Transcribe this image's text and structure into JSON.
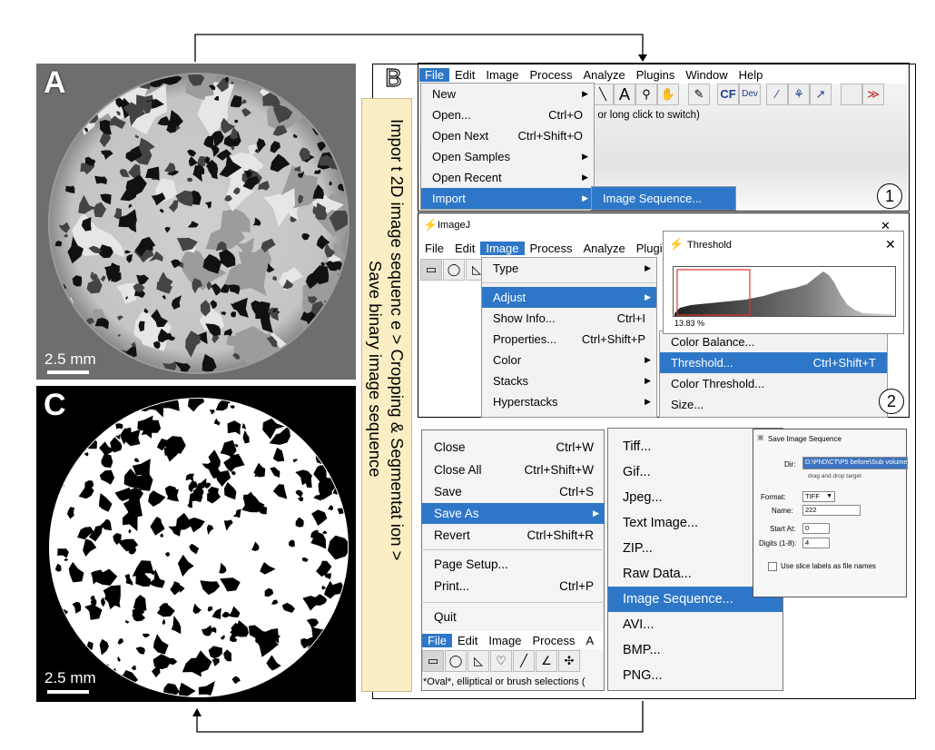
{
  "panels": {
    "a_label": "A",
    "b_label": "B",
    "c_label": "C",
    "scale_a": "2.5 mm",
    "scale_c": "2.5 mm"
  },
  "workflow_label": {
    "line1": "Impor t 2D image sequenc e > Cropping  & Segmentat ion >",
    "line2": "Save binary image sequence"
  },
  "step1": {
    "menubar": [
      "File",
      "Edit",
      "Image",
      "Process",
      "Analyze",
      "Plugins",
      "Window",
      "Help"
    ],
    "file_menu": [
      {
        "label": "New",
        "shortcut": "",
        "submenu": true
      },
      {
        "label": "Open...",
        "shortcut": "Ctrl+O",
        "submenu": false
      },
      {
        "label": "Open Next",
        "shortcut": "Ctrl+Shift+O",
        "submenu": false
      },
      {
        "label": "Open Samples",
        "shortcut": "",
        "submenu": true
      },
      {
        "label": "Open Recent",
        "shortcut": "",
        "submenu": true
      },
      {
        "label": "Import",
        "shortcut": "",
        "submenu": true
      }
    ],
    "submenu_item": "Image Sequence...",
    "status_text": "t or long click to switch)",
    "tool_cf": "CF",
    "tool_dev": "Dev",
    "tool_more": "≫",
    "number": "1"
  },
  "step2": {
    "window_title": "ImageJ",
    "menubar": [
      "File",
      "Edit",
      "Image",
      "Process",
      "Analyze",
      "Plugi"
    ],
    "image_menu": [
      {
        "label": "Type",
        "shortcut": "",
        "submenu": true
      },
      {
        "label": "Adjust",
        "shortcut": "",
        "submenu": true
      },
      {
        "label": "Show Info...",
        "shortcut": "Ctrl+I",
        "submenu": false
      },
      {
        "label": "Properties...",
        "shortcut": "Ctrl+Shift+P",
        "submenu": false
      },
      {
        "label": "Color",
        "shortcut": "",
        "submenu": true
      },
      {
        "label": "Stacks",
        "shortcut": "",
        "submenu": true
      },
      {
        "label": "Hyperstacks",
        "shortcut": "",
        "submenu": true
      }
    ],
    "adjust_menu": [
      {
        "label": "Color Balance...",
        "shortcut": ""
      },
      {
        "label": "Threshold...",
        "shortcut": "Ctrl+Shift+T"
      },
      {
        "label": "Color Threshold...",
        "shortcut": ""
      },
      {
        "label": "Size...",
        "shortcut": ""
      }
    ],
    "threshold_title": "Threshold",
    "threshold_percent": "13.83 %",
    "close_glyph": "✕",
    "number": "2"
  },
  "step3": {
    "file_menu": [
      {
        "label": "Close",
        "shortcut": "Ctrl+W"
      },
      {
        "label": "Close All",
        "shortcut": "Ctrl+Shift+W"
      },
      {
        "label": "Save",
        "shortcut": "Ctrl+S"
      },
      {
        "label": "Save As",
        "shortcut": ""
      },
      {
        "label": "Revert",
        "shortcut": "Ctrl+Shift+R"
      },
      {
        "label": "Page Setup...",
        "shortcut": ""
      },
      {
        "label": "Print...",
        "shortcut": "Ctrl+P"
      },
      {
        "label": "Quit",
        "shortcut": ""
      }
    ],
    "menubar": [
      "File",
      "Edit",
      "Image",
      "Process",
      "A"
    ],
    "status_text": "*Oval*, elliptical or brush selections (",
    "save_as_menu": [
      "Tiff...",
      "Gif...",
      "Jpeg...",
      "Text Image...",
      "ZIP...",
      "Raw Data...",
      "Image Sequence...",
      "AVI...",
      "BMP...",
      "PNG..."
    ],
    "dialog": {
      "title": "Save Image Sequence",
      "dir_label": "Dir:",
      "dir_value": "D:\\PhD\\CT\\P5 before\\Sub volume",
      "drag_hint": "drag and drop target",
      "format_label": "Format:",
      "format_value": "TIFF",
      "name_label": "Name:",
      "name_value": "222",
      "start_label": "Start At:",
      "start_value": "0",
      "digits_label": "Digits (1-8):",
      "digits_value": "4",
      "checkbox_label": "Use slice labels as file names"
    }
  },
  "colors": {
    "highlight": "#2e77c8",
    "strip": "#fbeec4",
    "threshold_box": "#e0362c"
  }
}
